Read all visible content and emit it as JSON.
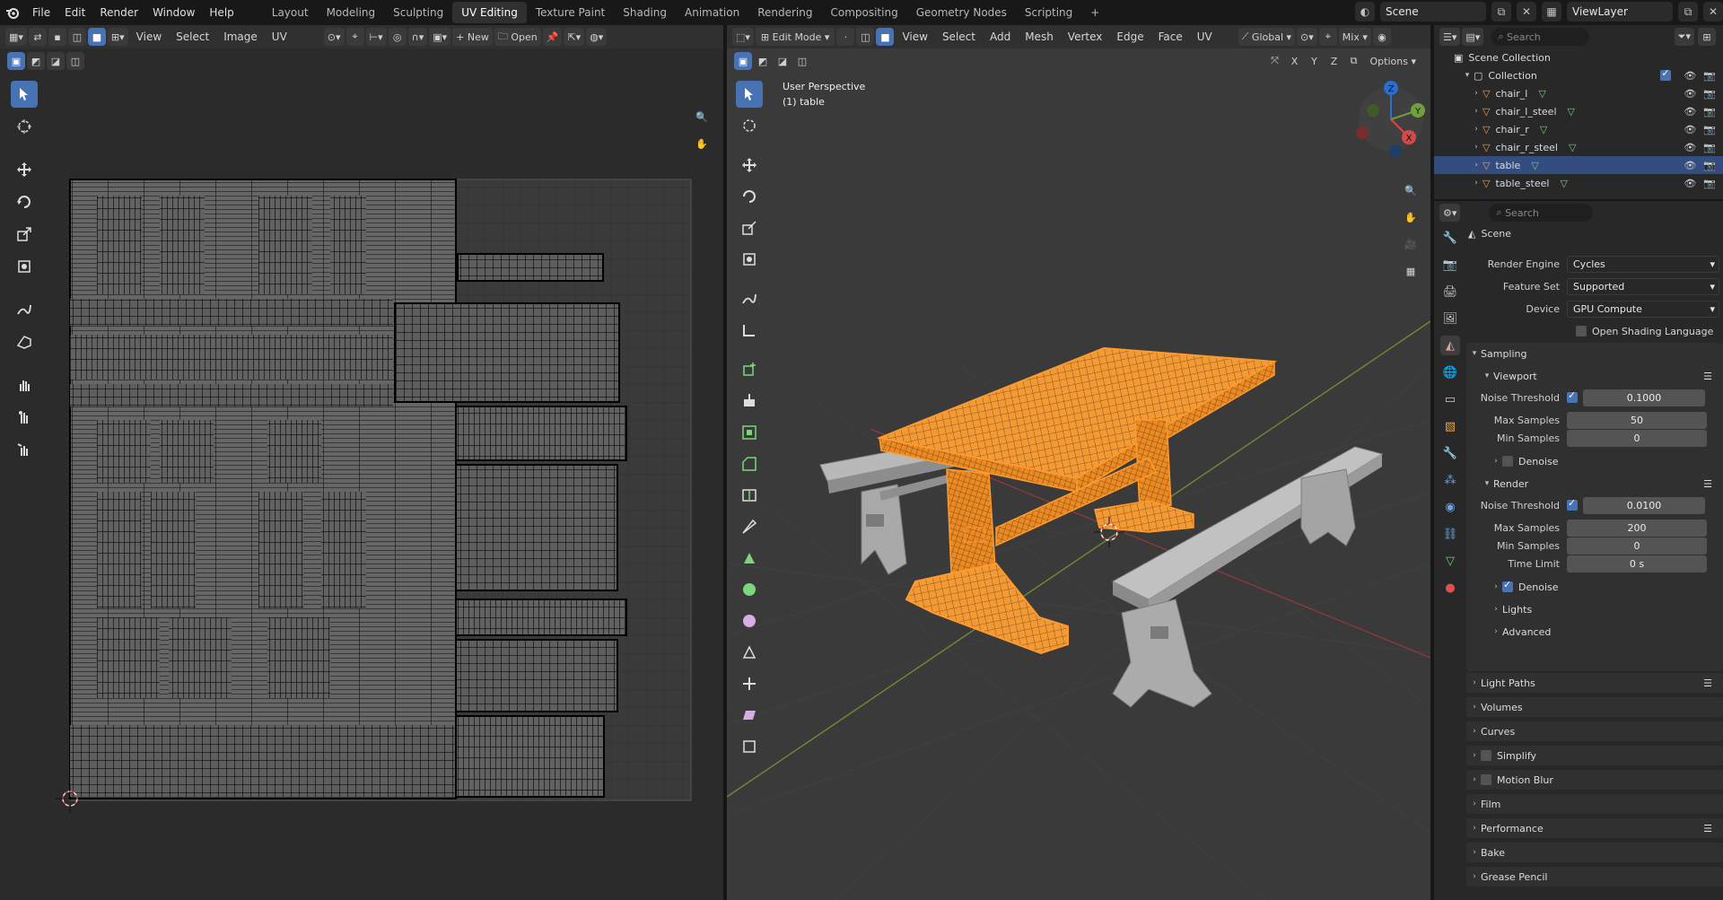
{
  "topbar": {
    "menus": [
      "File",
      "Edit",
      "Render",
      "Window",
      "Help"
    ],
    "workspaces": [
      "Layout",
      "Modeling",
      "Sculpting",
      "UV Editing",
      "Texture Paint",
      "Shading",
      "Animation",
      "Rendering",
      "Compositing",
      "Geometry Nodes",
      "Scripting"
    ],
    "active_workspace": "UV Editing",
    "add_workspace": "+",
    "scene": "Scene",
    "view_layer": "ViewLayer"
  },
  "uv_editor": {
    "menus": [
      "View",
      "Select",
      "Image",
      "UV"
    ],
    "new_label": "New",
    "open_label": "Open"
  },
  "viewport": {
    "mode": "Edit Mode",
    "menus": [
      "View",
      "Select",
      "Add",
      "Mesh",
      "Vertex",
      "Edge",
      "Face",
      "UV"
    ],
    "orientation": "Global",
    "proportional": "Mix",
    "options_label": "Options",
    "overlay_title": "User Perspective",
    "overlay_object": "(1) table",
    "axes": [
      "X",
      "Y",
      "Z"
    ],
    "gizmo_labels": [
      "Z",
      "Y",
      "X"
    ]
  },
  "outliner": {
    "search_placeholder": "Search",
    "scene_collection": "Scene Collection",
    "collection": "Collection",
    "objects": [
      {
        "name": "chair_l",
        "selected": false
      },
      {
        "name": "chair_l_steel",
        "selected": false
      },
      {
        "name": "chair_r",
        "selected": false
      },
      {
        "name": "chair_r_steel",
        "selected": false
      },
      {
        "name": "table",
        "selected": true
      },
      {
        "name": "table_steel",
        "selected": false
      }
    ]
  },
  "properties": {
    "search_placeholder": "Search",
    "context": "Scene",
    "render_engine": {
      "label": "Render Engine",
      "value": "Cycles"
    },
    "feature_set": {
      "label": "Feature Set",
      "value": "Supported"
    },
    "device": {
      "label": "Device",
      "value": "GPU Compute"
    },
    "osl": "Open Shading Language",
    "sampling": "Sampling",
    "viewport": {
      "title": "Viewport",
      "noise_threshold_label": "Noise Threshold",
      "noise_threshold": "0.1000",
      "max_samples_label": "Max Samples",
      "max_samples": "50",
      "min_samples_label": "Min Samples",
      "min_samples": "0",
      "denoise": "Denoise"
    },
    "render": {
      "title": "Render",
      "noise_threshold_label": "Noise Threshold",
      "noise_threshold": "0.0100",
      "max_samples_label": "Max Samples",
      "max_samples": "200",
      "min_samples_label": "Min Samples",
      "min_samples": "0",
      "time_limit_label": "Time Limit",
      "time_limit": "0 s",
      "denoise": "Denoise"
    },
    "sub_panels": [
      "Lights",
      "Advanced"
    ],
    "panels": [
      "Light Paths",
      "Volumes",
      "Curves",
      "Simplify",
      "Motion Blur",
      "Film",
      "Performance",
      "Bake",
      "Grease Pencil"
    ]
  },
  "colors": {
    "accent": "#4772b3",
    "selection_orange": "#ff9a2e",
    "outliner_selected": "#334d80"
  }
}
